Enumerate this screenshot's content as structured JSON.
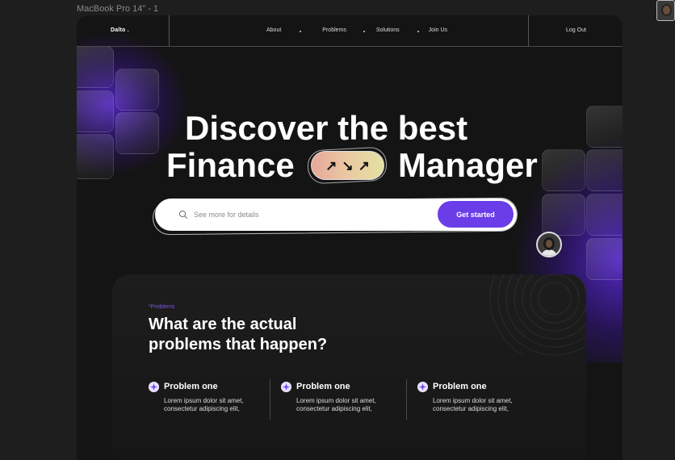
{
  "frame_label": "MacBook Pro 14\" - 1",
  "nav": {
    "logo": "Dalto .",
    "links": [
      "About",
      "Problems",
      "Solutions",
      "Join Us"
    ],
    "logout": "Log Out"
  },
  "hero": {
    "line1": "Discover the best",
    "line2_left": "Finance",
    "line2_right": "Manager",
    "pill_arrows": [
      "↗",
      "↘",
      "↗"
    ]
  },
  "search": {
    "placeholder": "See more for details",
    "button": "Get started"
  },
  "problems": {
    "tag": "*Problems",
    "heading_line1": "What are the actual",
    "heading_line2": "problems that happen?",
    "items": [
      {
        "title": "Problem one",
        "body": "Lorem ipsum dolor sit amet, consectetur adipiscing elit,"
      },
      {
        "title": "Problem one",
        "body": "Lorem ipsum dolor sit amet, consectetur adipiscing elit,"
      },
      {
        "title": "Problem one",
        "body": "Lorem ipsum dolor sit amet, consectetur adipiscing elit,"
      }
    ]
  },
  "colors": {
    "accent": "#6a3de8",
    "tag": "#7b52f0",
    "background": "#141414"
  },
  "icons": [
    "search-icon",
    "sparkle-icon",
    "avatar"
  ]
}
